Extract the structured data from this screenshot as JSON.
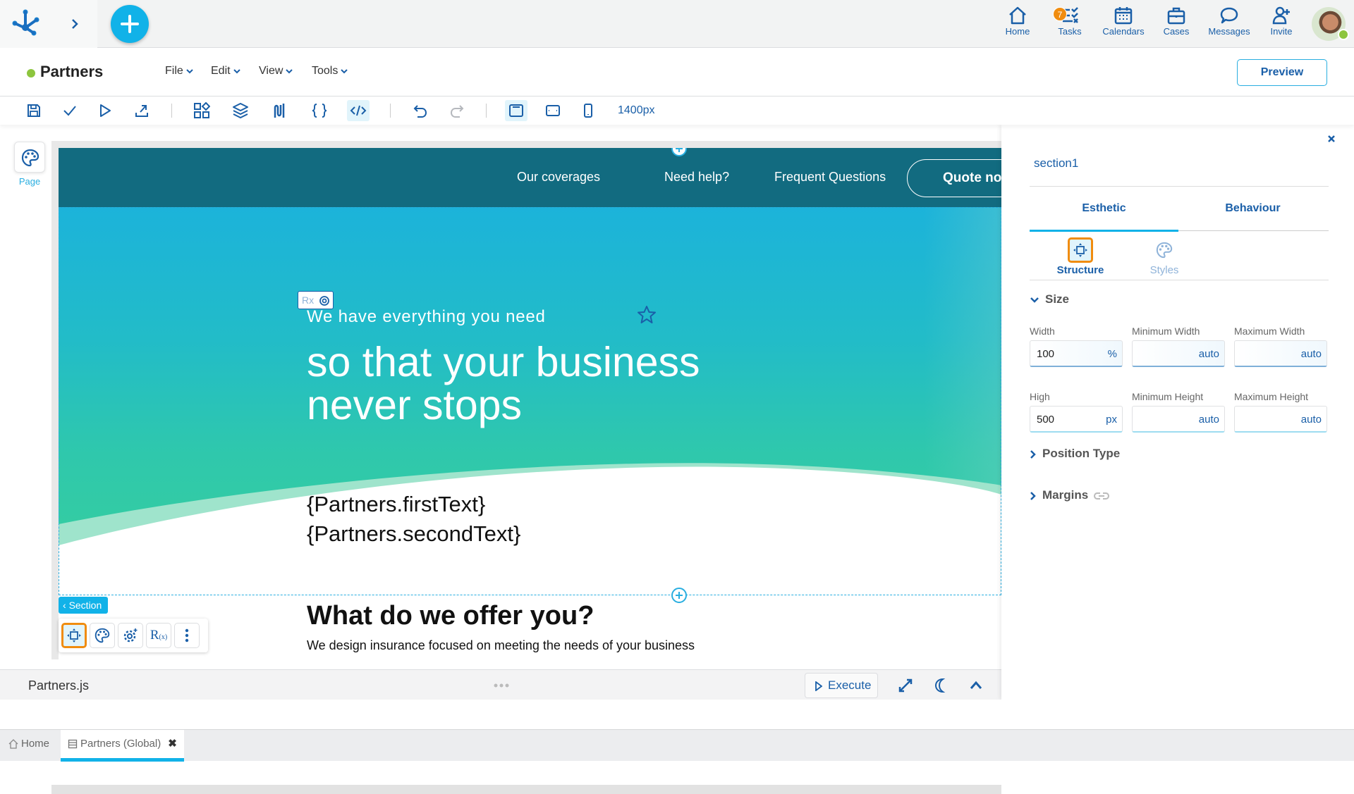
{
  "topbar": {
    "nav": [
      {
        "label": "Home",
        "icon": "home-icon"
      },
      {
        "label": "Tasks",
        "icon": "tasks-icon",
        "badge": "7"
      },
      {
        "label": "Calendars",
        "icon": "calendar-icon"
      },
      {
        "label": "Cases",
        "icon": "briefcase-icon"
      },
      {
        "label": "Messages",
        "icon": "chat-icon"
      },
      {
        "label": "Invite",
        "icon": "add-user-icon"
      }
    ],
    "user_status_color": "#8dc53e"
  },
  "titlebar": {
    "title": "Partners",
    "menus": [
      "File",
      "Edit",
      "View",
      "Tools"
    ],
    "preview_label": "Preview"
  },
  "toolbar": {
    "viewport_size": "1400px"
  },
  "left_panel": {
    "page_label": "Page"
  },
  "canvas": {
    "nav_links": [
      "Our coverages",
      "Need help?",
      "Frequent Questions"
    ],
    "quote_button": "Quote now",
    "rx_label": "Rx",
    "hero_subtitle": "We have everything you need",
    "hero_title": "so that your business never stops",
    "bind_first": "{Partners.firstText}",
    "bind_second": "{Partners.secondText}",
    "offer_title": "What do we offer you?",
    "offer_text": "We design insurance focused on meeting the needs of your business",
    "section_tag": "Section"
  },
  "jsbar": {
    "file_name": "Partners.js",
    "execute_label": "Execute"
  },
  "right_panel": {
    "element_name": "section1",
    "tabs": [
      "Esthetic",
      "Behaviour"
    ],
    "active_tab": "Esthetic",
    "subtabs": [
      "Structure",
      "Styles"
    ],
    "active_subtab": "Structure",
    "size_section": "Size",
    "fields": {
      "width": {
        "label": "Width",
        "value": "100",
        "unit": "%"
      },
      "min_width": {
        "label": "Minimum Width",
        "value": "auto"
      },
      "max_width": {
        "label": "Maximum Width",
        "value": "auto"
      },
      "height": {
        "label": "High",
        "value": "500",
        "unit": "px"
      },
      "min_height": {
        "label": "Minimum Height",
        "value": "auto"
      },
      "max_height": {
        "label": "Maximum Height",
        "value": "auto"
      }
    },
    "position_type": "Position Type",
    "margins": "Margins"
  },
  "bottom_tabs": [
    {
      "label": "Home"
    },
    {
      "label": "Partners (Global)"
    }
  ],
  "colors": {
    "accent": "#11b2e8",
    "primary": "#1a5fa8",
    "highlight": "#f08c0f",
    "site_nav": "#126b80"
  }
}
